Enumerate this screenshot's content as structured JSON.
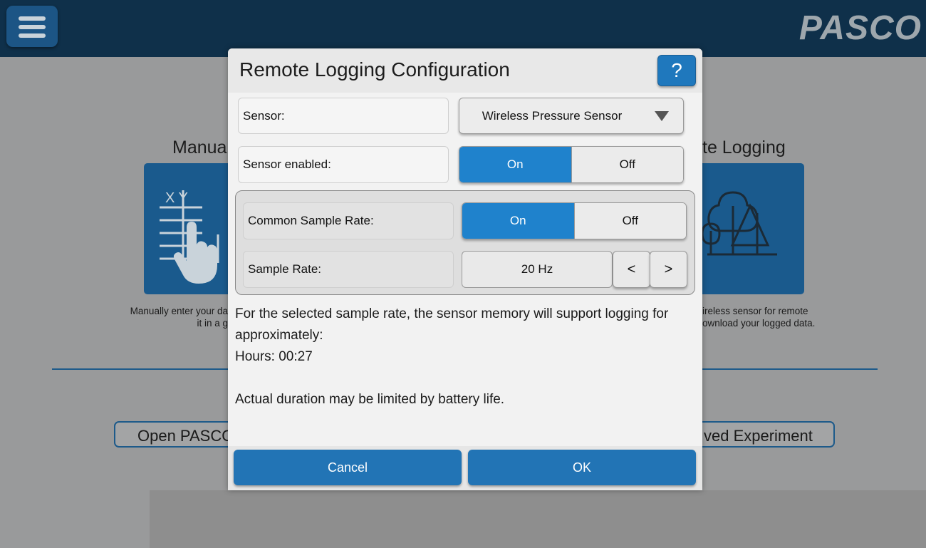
{
  "app": {
    "logo": "PASCO",
    "background": {
      "left_title": "Manua",
      "right_title": "te Logging",
      "left_desc_line1": "Manually enter your da",
      "left_desc_line2": "it in a g",
      "right_desc_line1": "ireless sensor for remote",
      "right_desc_line2": "ownload your logged data.",
      "open_button": "Open PASCO",
      "saved_button": "ved Experiment",
      "xy_label": "X Y"
    }
  },
  "dialog": {
    "title": "Remote Logging Configuration",
    "help_label": "?",
    "sensor": {
      "label": "Sensor:",
      "value": "Wireless Pressure Sensor"
    },
    "sensor_enabled": {
      "label": "Sensor enabled:",
      "on_label": "On",
      "off_label": "Off",
      "selected": "On"
    },
    "common_sample_rate": {
      "label": "Common Sample Rate:",
      "on_label": "On",
      "off_label": "Off",
      "selected": "On"
    },
    "sample_rate": {
      "label": "Sample Rate:",
      "value": "20 Hz",
      "decrement": "<",
      "increment": ">"
    },
    "info": {
      "line1": "For the selected sample rate, the sensor memory will support logging for approximately:",
      "line2": "Hours: 00:27",
      "line3": "Actual duration may be limited by battery life."
    },
    "cancel_label": "Cancel",
    "ok_label": "OK"
  },
  "colors": {
    "topbar": "#0f304a",
    "accent_blue": "#1f82cc",
    "button_blue": "#2274b5"
  }
}
